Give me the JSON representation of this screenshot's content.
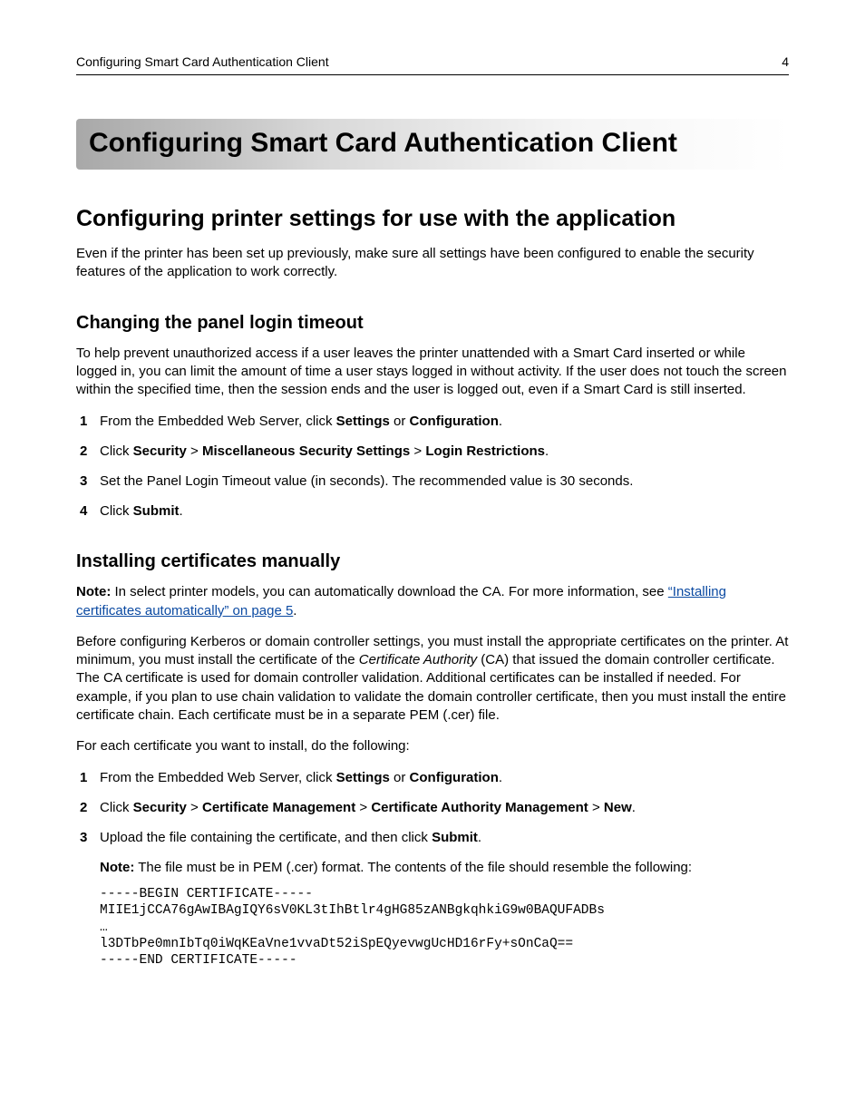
{
  "header": {
    "left": "Configuring Smart Card Authentication Client",
    "page_number": "4"
  },
  "title": "Configuring Smart Card Authentication Client",
  "section1": {
    "heading": "Configuring printer settings for use with the application",
    "intro": "Even if the printer has been set up previously, make sure all settings have been configured to enable the security features of the application to work correctly."
  },
  "sub_timeout": {
    "heading": "Changing the panel login timeout",
    "para": "To help prevent unauthorized access if a user leaves the printer unattended with a Smart Card inserted or while logged in, you can limit the amount of time a user stays logged in without activity. If the user does not touch the screen within the specified time, then the session ends and the user is logged out, even if a Smart Card is still inserted.",
    "steps": {
      "s1_a": "From the Embedded Web Server, click ",
      "s1_b": "Settings",
      "s1_c": " or ",
      "s1_d": "Configuration",
      "s1_e": ".",
      "s2_a": "Click ",
      "s2_b": "Security",
      "s2_c": " > ",
      "s2_d": "Miscellaneous Security Settings",
      "s2_e": " > ",
      "s2_f": "Login Restrictions",
      "s2_g": ".",
      "s3": "Set the Panel Login Timeout value (in seconds). The recommended value is 30 seconds.",
      "s4_a": "Click ",
      "s4_b": "Submit",
      "s4_c": "."
    }
  },
  "sub_cert": {
    "heading": "Installing certificates manually",
    "note_label": "Note:",
    "note_a": " In select printer models, you can automatically download the CA. For more information, see ",
    "note_link": "“Installing certificates automatically” on page 5",
    "note_b": ".",
    "para2_a": "Before configuring Kerberos or domain controller settings, you must install the appropriate certificates on the printer. At minimum, you must install the certificate of the ",
    "para2_b": "Certificate Authority",
    "para2_c": " (CA) that issued the domain controller certificate. The CA certificate is used for domain controller validation. Additional certificates can be installed if needed. For example, if you plan to use chain validation to validate the domain controller certificate, then you must install the entire certificate chain. Each certificate must be in a separate PEM (.cer) file.",
    "para3": "For each certificate you want to install, do the following:",
    "steps": {
      "s1_a": "From the Embedded Web Server, click ",
      "s1_b": "Settings",
      "s1_c": " or ",
      "s1_d": "Configuration",
      "s1_e": ".",
      "s2_a": "Click ",
      "s2_b": "Security",
      "s2_c": " > ",
      "s2_d": "Certificate Management",
      "s2_e": " > ",
      "s2_f": "Certificate Authority Management",
      "s2_g": " > ",
      "s2_h": "New",
      "s2_i": ".",
      "s3_a": "Upload the file containing the certificate, and then click ",
      "s3_b": "Submit",
      "s3_c": "."
    },
    "note2_label": "Note:",
    "note2_text": " The file must be in PEM (.cer) format. The contents of the file should resemble the following:",
    "cert_block": "-----BEGIN CERTIFICATE-----\nMIIE1jCCA76gAwIBAgIQY6sV0KL3tIhBtlr4gHG85zANBgkqhkiG9w0BAQUFADBs\n…\nl3DTbPe0mnIbTq0iWqKEaVne1vvaDt52iSpEQyevwgUcHD16rFy+sOnCaQ==\n-----END CERTIFICATE-----"
  }
}
